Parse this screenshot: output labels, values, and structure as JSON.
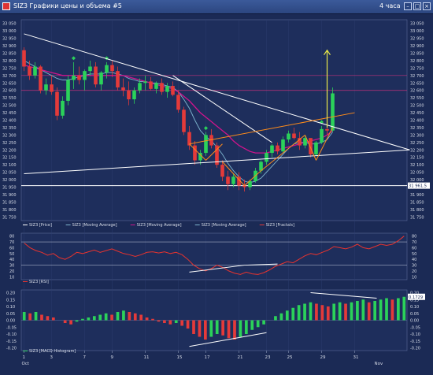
{
  "window": {
    "title": "SIZ3 Графики цены и объема #5",
    "timeframe": "4 часа",
    "icons": {
      "app": "chart-app-icon",
      "minimize": "minimize-icon",
      "maximize": "maximize-icon",
      "close": "close-icon"
    }
  },
  "colors": {
    "background": "#1b2a55",
    "bull_candle": "#2bd25a",
    "bear_candle": "#e43a3a",
    "ma_fast": "#7fb6cf",
    "ma_slow": "#d0148c",
    "trendline": "#ffffff",
    "channel": "#ff8c1a",
    "arrow": "#e8e84a",
    "rsi_line": "#e8332e"
  },
  "chart_data": [
    {
      "type": "candlestick",
      "panel": "price",
      "title": "",
      "y_ticks": [
        "33 050",
        "33 000",
        "32 950",
        "32 900",
        "32 850",
        "32 800",
        "32 750",
        "32 700",
        "32 650",
        "32 600",
        "32 550",
        "32 500",
        "32 450",
        "32 400",
        "32 350",
        "32 300",
        "32 250",
        "32 200",
        "32 150",
        "32 100",
        "32 050",
        "32 000",
        "31 950",
        "31 900",
        "31 850",
        "31 800",
        "31 750"
      ],
      "ylim": [
        31725,
        33075
      ],
      "x_ticks": [
        "1",
        "3",
        "7",
        "9",
        "11",
        "15",
        "17",
        "21",
        "23",
        "25",
        "29",
        "31"
      ],
      "x_tick_bars": [
        0,
        5,
        11,
        16,
        22,
        28,
        33,
        39,
        44,
        48,
        54,
        60
      ],
      "x_month_labels": [
        {
          "label": "Oct",
          "bar": 0
        },
        {
          "label": "Nov",
          "bar": 64
        }
      ],
      "ohlc": [
        [
          32870,
          32890,
          32730,
          32760
        ],
        [
          32760,
          32800,
          32670,
          32700
        ],
        [
          32700,
          32790,
          32680,
          32760
        ],
        [
          32760,
          32770,
          32580,
          32600
        ],
        [
          32600,
          32680,
          32570,
          32640
        ],
        [
          32640,
          32700,
          32570,
          32590
        ],
        [
          32590,
          32620,
          32400,
          32430
        ],
        [
          32430,
          32560,
          32410,
          32530
        ],
        [
          32530,
          32700,
          32500,
          32670
        ],
        [
          32670,
          32790,
          32610,
          32700
        ],
        [
          32700,
          32760,
          32640,
          32670
        ],
        [
          32670,
          32740,
          32600,
          32730
        ],
        [
          32730,
          32800,
          32700,
          32760
        ],
        [
          32760,
          32790,
          32620,
          32640
        ],
        [
          32640,
          32730,
          32600,
          32720
        ],
        [
          32720,
          32790,
          32680,
          32770
        ],
        [
          32770,
          32800,
          32690,
          32730
        ],
        [
          32730,
          32760,
          32600,
          32620
        ],
        [
          32620,
          32680,
          32560,
          32600
        ],
        [
          32600,
          32660,
          32500,
          32540
        ],
        [
          32540,
          32620,
          32510,
          32600
        ],
        [
          32600,
          32680,
          32580,
          32650
        ],
        [
          32650,
          32700,
          32600,
          32660
        ],
        [
          32660,
          32690,
          32600,
          32610
        ],
        [
          32610,
          32660,
          32580,
          32650
        ],
        [
          32650,
          32680,
          32570,
          32590
        ],
        [
          32590,
          32650,
          32550,
          32630
        ],
        [
          32630,
          32660,
          32560,
          32570
        ],
        [
          32570,
          32600,
          32450,
          32470
        ],
        [
          32470,
          32490,
          32300,
          32320
        ],
        [
          32320,
          32360,
          32200,
          32230
        ],
        [
          32230,
          32260,
          32100,
          32130
        ],
        [
          32130,
          32200,
          32100,
          32180
        ],
        [
          32180,
          32320,
          32160,
          32300
        ],
        [
          32300,
          32340,
          32210,
          32230
        ],
        [
          32230,
          32250,
          32080,
          32100
        ],
        [
          32100,
          32130,
          31990,
          32020
        ],
        [
          32020,
          32060,
          31930,
          31970
        ],
        [
          31970,
          32040,
          31950,
          32020
        ],
        [
          32020,
          32050,
          31930,
          31960
        ],
        [
          31960,
          32000,
          31920,
          31950
        ],
        [
          31950,
          32000,
          31930,
          31990
        ],
        [
          31990,
          32080,
          31980,
          32060
        ],
        [
          32060,
          32130,
          32040,
          32120
        ],
        [
          32120,
          32200,
          32100,
          32180
        ],
        [
          32180,
          32240,
          32150,
          32230
        ],
        [
          32230,
          32250,
          32170,
          32190
        ],
        [
          32190,
          32290,
          32180,
          32270
        ],
        [
          32270,
          32330,
          32250,
          32310
        ],
        [
          32310,
          32350,
          32270,
          32280
        ],
        [
          32280,
          32320,
          32200,
          32230
        ],
        [
          32230,
          32300,
          32210,
          32280
        ],
        [
          32280,
          32260,
          32150,
          32170
        ],
        [
          32170,
          32260,
          32160,
          32250
        ],
        [
          32250,
          32360,
          32240,
          32340
        ],
        [
          32340,
          32360,
          32300,
          32330
        ],
        [
          32330,
          32620,
          32320,
          32580
        ]
      ],
      "series": [
        {
          "name": "SIZ3 [Moving Average]",
          "values": [
            32800,
            32780,
            32760,
            32740,
            32720,
            32700,
            32680,
            32670,
            32670,
            32680,
            32690,
            32700,
            32710,
            32710,
            32710,
            32720,
            32720,
            32710,
            32700,
            32680,
            32670,
            32660,
            32660,
            32650,
            32650,
            32640,
            32630,
            32620,
            32590,
            32540,
            32480,
            32400,
            32330,
            32290,
            32260,
            32220,
            32170,
            32110,
            32060,
            32020,
            31990,
            31980,
            31990,
            32010,
            32050,
            32090,
            32130,
            32170,
            32210,
            32240,
            32250,
            32250,
            32240,
            32240,
            32250,
            32270,
            32320
          ]
        },
        {
          "name": "SIZ3 [Moving Average]",
          "values": [
            32770,
            32760,
            32750,
            32740,
            32730,
            32720,
            32710,
            32700,
            32700,
            32700,
            32700,
            32700,
            32700,
            32700,
            32700,
            32700,
            32700,
            32700,
            32700,
            32690,
            32680,
            32670,
            32660,
            32650,
            32640,
            32630,
            32620,
            32610,
            32590,
            32560,
            32530,
            32490,
            32450,
            32420,
            32390,
            32360,
            32330,
            32300,
            32260,
            32230,
            32210,
            32190,
            32180,
            32180,
            32180,
            32190,
            32200,
            32210,
            32220,
            32230,
            32240,
            32250,
            32260,
            32270,
            32280,
            32300,
            32330
          ]
        }
      ],
      "fractals_up": [
        9,
        15,
        33,
        54
      ],
      "horizontal_levels": [
        32700,
        32600,
        31960
      ],
      "level_label": "31 961.5",
      "trendlines": [
        {
          "from": [
            0,
            32980
          ],
          "to": [
            70,
            32200
          ],
          "color": "#ffffff"
        },
        {
          "from": [
            0,
            32040
          ],
          "to": [
            70,
            32200
          ],
          "color": "#ffffff"
        },
        {
          "from": [
            27,
            32700
          ],
          "to": [
            45,
            32250
          ],
          "color": "#ffffff"
        }
      ],
      "channel": [
        {
          "from": [
            30,
            32240
          ],
          "to": [
            60,
            32450
          ],
          "color": "#ff8c1a"
        },
        {
          "from": [
            30,
            32240
          ],
          "to": [
            33,
            32130
          ],
          "color": "#ff8c1a"
        },
        {
          "from": [
            33,
            32130
          ],
          "to": [
            36,
            32240
          ],
          "color": "#ff8c1a"
        },
        {
          "from": [
            36,
            32120
          ],
          "to": [
            40,
            31960
          ],
          "color": "#ff8c1a"
        },
        {
          "from": [
            40,
            31960
          ],
          "to": [
            43,
            32060
          ],
          "color": "#ff8c1a"
        },
        {
          "from": [
            43,
            32060
          ],
          "to": [
            51,
            32300
          ],
          "color": "#ff8c1a"
        },
        {
          "from": [
            51,
            32300
          ],
          "to": [
            53,
            32130
          ],
          "color": "#ff8c1a"
        },
        {
          "from": [
            53,
            32130
          ],
          "to": [
            56,
            32350
          ],
          "color": "#ff8c1a"
        }
      ],
      "arrow": {
        "from": [
          55,
          32350
        ],
        "to": [
          55,
          32870
        ]
      },
      "legend": [
        "SIZ3 [Price]",
        "SIZ3 [Moving Average]",
        "SIZ3 [Moving Average]",
        "SIZ3 [Moving Average]",
        "SIZ3 [Fractals]"
      ]
    },
    {
      "type": "line",
      "panel": "rsi",
      "name": "SIZ3 [RSI]",
      "y_ticks": [
        "80",
        "70",
        "60",
        "50",
        "40",
        "30",
        "20",
        "10"
      ],
      "ylim": [
        5,
        85
      ],
      "levels": [
        70,
        30
      ],
      "values": [
        68,
        60,
        55,
        52,
        47,
        50,
        43,
        40,
        45,
        52,
        50,
        53,
        56,
        52,
        55,
        58,
        54,
        50,
        48,
        45,
        48,
        52,
        53,
        51,
        53,
        50,
        52,
        48,
        40,
        30,
        24,
        20,
        24,
        30,
        26,
        20,
        16,
        14,
        18,
        15,
        14,
        17,
        22,
        28,
        32,
        36,
        34,
        40,
        46,
        50,
        48,
        52,
        56,
        62,
        60,
        58,
        61,
        66,
        60,
        58,
        62,
        66,
        64,
        66,
        72,
        80
      ],
      "divergence_lines": [
        {
          "from": [
            30,
            18
          ],
          "to": [
            40,
            30
          ]
        },
        {
          "from": [
            40,
            30
          ],
          "to": [
            46,
            32
          ]
        }
      ]
    },
    {
      "type": "bar",
      "panel": "macd",
      "name": "SIZ3 [MACD Histogram]",
      "y_ticks": [
        "0.20",
        "0.15",
        "0.10",
        "0.05",
        "0.00",
        "-0.05",
        "-0.10",
        "-0.15",
        "-0.20"
      ],
      "ylim": [
        -0.22,
        0.22
      ],
      "value_label": "0.1729",
      "values": [
        0.06,
        0.05,
        0.06,
        0.04,
        0.03,
        0.02,
        0.0,
        -0.02,
        -0.03,
        -0.01,
        0.01,
        0.02,
        0.03,
        0.04,
        0.05,
        0.04,
        0.06,
        0.07,
        0.06,
        0.05,
        0.04,
        0.02,
        0.01,
        -0.01,
        -0.02,
        -0.03,
        -0.02,
        -0.04,
        -0.06,
        -0.1,
        -0.12,
        -0.14,
        -0.12,
        -0.1,
        -0.11,
        -0.13,
        -0.14,
        -0.12,
        -0.1,
        -0.07,
        -0.05,
        -0.03,
        0.0,
        0.03,
        0.05,
        0.07,
        0.09,
        0.11,
        0.12,
        0.13,
        0.12,
        0.11,
        0.1,
        0.12,
        0.13,
        0.12,
        0.13,
        0.14,
        0.15,
        0.13,
        0.14,
        0.15,
        0.16,
        0.15,
        0.16,
        0.17
      ],
      "divergence_lines": [
        {
          "from": [
            30,
            -0.19
          ],
          "to": [
            44,
            -0.09
          ]
        },
        {
          "from": [
            52,
            0.2
          ],
          "to": [
            64,
            0.16
          ]
        }
      ]
    }
  ]
}
